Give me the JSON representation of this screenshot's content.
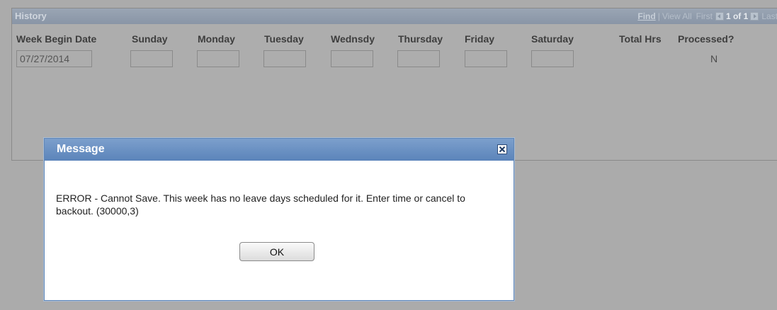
{
  "grid": {
    "title": "History",
    "nav": {
      "find": "Find",
      "separator": "|",
      "view_all": "View All",
      "first": "First",
      "page_info": "1 of 1",
      "last": "Last"
    },
    "columns": {
      "week_begin": "Week Begin Date",
      "sunday": "Sunday",
      "monday": "Monday",
      "tuesday": "Tuesday",
      "wednesday": "Wednsdy",
      "thursday": "Thursday",
      "friday": "Friday",
      "saturday": "Saturday",
      "total_hrs": "Total Hrs",
      "processed": "Processed?"
    },
    "row": {
      "week_begin_date": "07/27/2014",
      "sunday": "",
      "monday": "",
      "tuesday": "",
      "wednesday": "",
      "thursday": "",
      "friday": "",
      "saturday": "",
      "processed": "N"
    }
  },
  "modal": {
    "title": "Message",
    "close_icon": "close-x-icon",
    "message": "ERROR - Cannot Save.  This week has no leave days scheduled for it.  Enter time or cancel to backout. (30000,3)",
    "ok_label": "OK"
  },
  "colors": {
    "overlay": "#ababab",
    "modal_title_bar": "#5b84ba",
    "grid_header": "#8e9aab"
  }
}
